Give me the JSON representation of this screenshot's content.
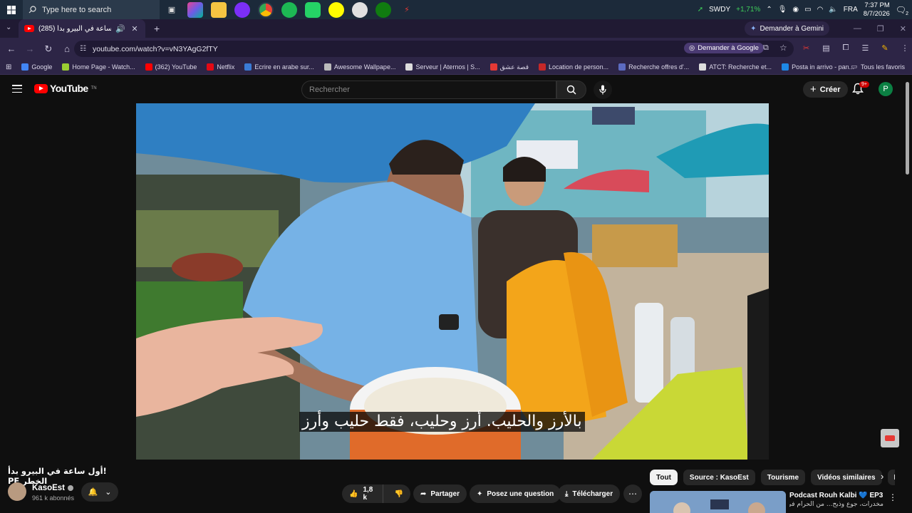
{
  "taskbar": {
    "search_placeholder": "Type here to search",
    "stock_symbol": "SWDY",
    "stock_change": "+1,71%",
    "language": "FRA",
    "time": "7:37 PM",
    "date": "8/7/2026",
    "notification_count": "2"
  },
  "browser": {
    "tab_title": "(285) أول ساعة في البيرو بدأ",
    "gemini_label": "Demander à Gemini",
    "url": "youtube.com/watch?v=vN3YAgG2fTY",
    "ask_google_label": "Demander à Google"
  },
  "bookmarks": {
    "items": [
      {
        "label": "Google",
        "color": "#4285f4"
      },
      {
        "label": "Home Page - Watch...",
        "color": "#9acd32"
      },
      {
        "label": "(362) YouTube",
        "color": "#ff0000"
      },
      {
        "label": "Netflix",
        "color": "#e50914"
      },
      {
        "label": "Ecrire en arabe sur...",
        "color": "#3a7bd5"
      },
      {
        "label": "Awesome Wallpape...",
        "color": "#bbbbbb"
      },
      {
        "label": "Serveur | Aternos | S...",
        "color": "#dddddd"
      },
      {
        "label": "قصة عشق",
        "color": "#e53935"
      },
      {
        "label": "Location de person...",
        "color": "#c62828"
      },
      {
        "label": "Recherche offres d'...",
        "color": "#5c6bc0"
      },
      {
        "label": "ATCT: Recherche et...",
        "color": "#dddddd"
      },
      {
        "label": "Posta in arrivo - pan...",
        "color": "#1e88e5"
      }
    ],
    "all_label": "Tous les favoris"
  },
  "youtube": {
    "logo_text": "YouTube",
    "logo_sup": "TN",
    "search_placeholder": "Rechercher",
    "create_label": "Créer",
    "notif_badge": "9+",
    "avatar_letter": "P",
    "subtitle": "بالأرز والحليب. أرز وحليب، فقط حليب وأرز",
    "video_title": "!أول ساعة في البيرو بدأ الخطر PE",
    "channel_name": "KasoEst",
    "subscribers": "961 k abonnés",
    "likes": "1,8 k",
    "share_label": "Partager",
    "ask_label": "Posez une question",
    "download_label": "Télécharger",
    "chips": [
      "Tout",
      "Source : KasoEst",
      "Tourisme",
      "Vidéos similaires",
      "Pou"
    ],
    "rec_title": "Podcast Rouh Kalbi 💙 EP3 |",
    "rec_subtitle": "مخدرات، جوع وذبح... من الحرام في الغربة"
  },
  "colors": {
    "youtube_red": "#ff0000",
    "stock_green": "#3fcf5a",
    "page_bg": "#0f0f0f"
  }
}
